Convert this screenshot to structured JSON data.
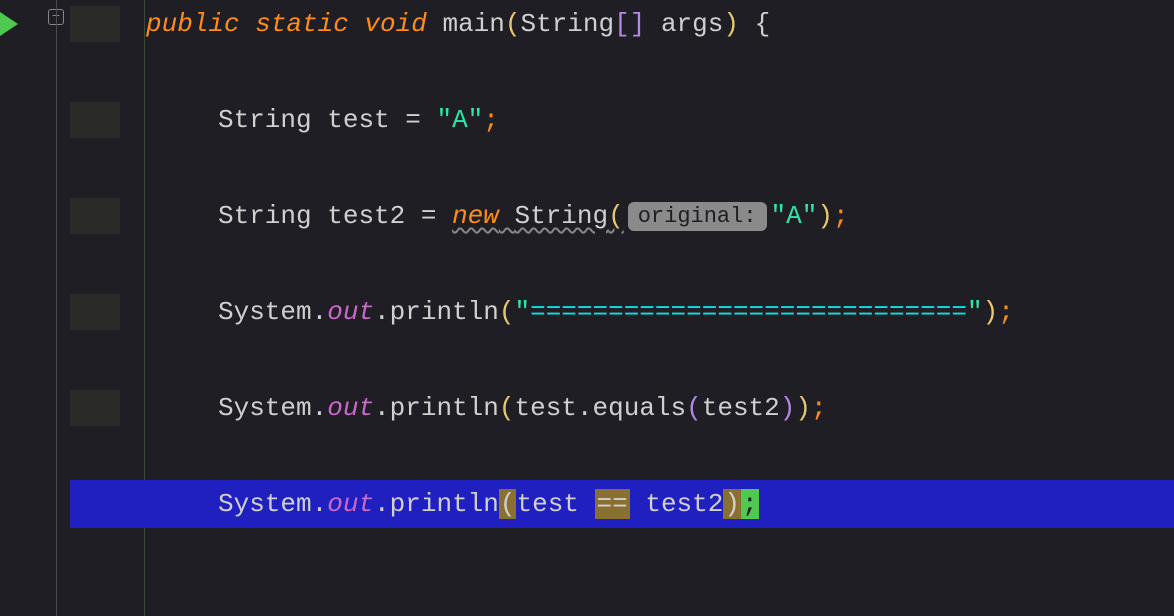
{
  "code": {
    "line1": {
      "modifiers": "public static void",
      "method": "main",
      "paramType": "String",
      "brackets": "[]",
      "paramName": "args"
    },
    "line3": {
      "type": "String",
      "varName": "test",
      "value": "\"A\""
    },
    "line5": {
      "type": "String",
      "varName": "test2",
      "newKw": "new",
      "ctor": "String",
      "hint": "original:",
      "value": "\"A\""
    },
    "line7": {
      "obj": "System",
      "field": "out",
      "method": "println",
      "strOpen": "\"",
      "strContent": "============================",
      "strClose": "\""
    },
    "line9": {
      "obj": "System",
      "field": "out",
      "method": "println",
      "arg1": "test",
      "eqMethod": "equals",
      "arg2": "test2"
    },
    "line11": {
      "obj": "System",
      "field": "out",
      "method": "println",
      "arg1": "test",
      "op": "==",
      "arg2": "test2"
    }
  }
}
